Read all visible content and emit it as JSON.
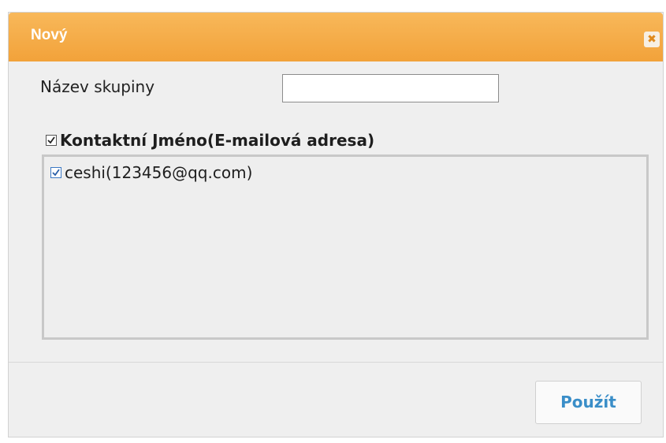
{
  "dialog": {
    "title": "Nový",
    "close_icon": "close-icon",
    "close_glyph": "✖"
  },
  "form": {
    "group_name_label": "Název skupiny",
    "group_name_value": "",
    "group_name_placeholder": ""
  },
  "contacts": {
    "header_label": "Kontaktní Jméno(E-mailová adresa)",
    "header_checked": true,
    "items": [
      {
        "label": "ceshi(123456@qq.com)",
        "checked": true
      }
    ]
  },
  "footer": {
    "apply_label": "Použít"
  },
  "colors": {
    "titlebar": "#f2a23a",
    "title_text": "#ffffff",
    "apply_text": "#3a8ec8",
    "dialog_bg": "#efefef"
  }
}
